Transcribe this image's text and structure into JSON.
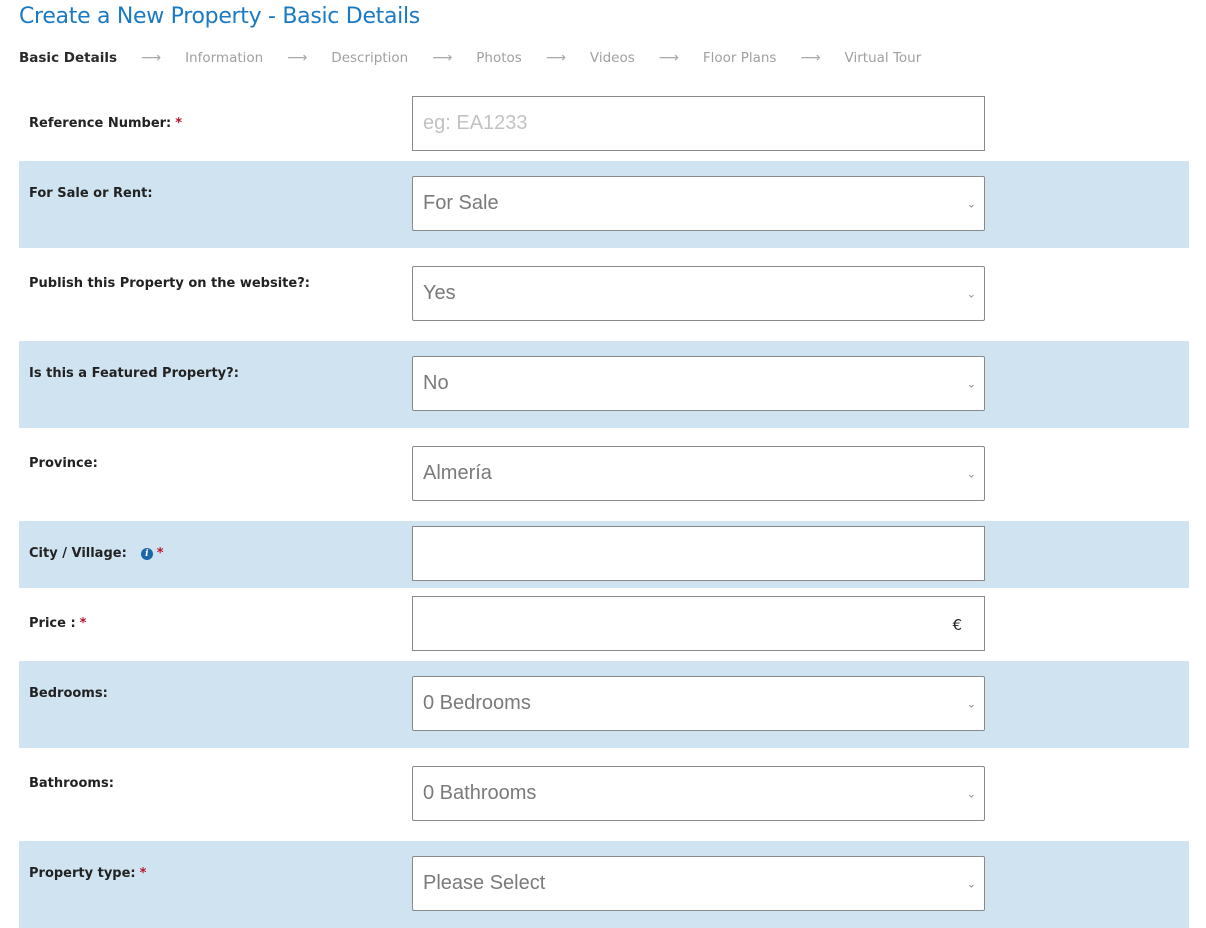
{
  "page": {
    "title": "Create a New Property - Basic Details"
  },
  "steps": [
    {
      "label": "Basic Details",
      "active": true
    },
    {
      "label": "Information",
      "active": false
    },
    {
      "label": "Description",
      "active": false
    },
    {
      "label": "Photos",
      "active": false
    },
    {
      "label": "Videos",
      "active": false
    },
    {
      "label": "Floor Plans",
      "active": false
    },
    {
      "label": "Virtual Tour",
      "active": false
    }
  ],
  "step_arrow": "⟶",
  "form": {
    "reference": {
      "label": "Reference Number:",
      "required": "*",
      "value": "",
      "placeholder": "eg: EA1233"
    },
    "sale_rent": {
      "label": "For Sale or Rent:",
      "value": "For Sale"
    },
    "publish": {
      "label": "Publish this Property on the website?:",
      "value": "Yes"
    },
    "featured": {
      "label": "Is this a Featured Property?:",
      "value": "No"
    },
    "province": {
      "label": "Province:",
      "value": "Almería"
    },
    "city": {
      "label": "City / Village:",
      "info_icon": "i",
      "required": "*",
      "value": ""
    },
    "price": {
      "label": "Price :",
      "required": "*",
      "value": "",
      "currency": "€"
    },
    "bedrooms": {
      "label": "Bedrooms:",
      "value": "0 Bedrooms"
    },
    "bathrooms": {
      "label": "Bathrooms:",
      "value": "0 Bathrooms"
    },
    "property_type": {
      "label": "Property type:",
      "required": "*",
      "value": "Please Select"
    }
  },
  "icons": {
    "chevron": "⌄"
  },
  "colors": {
    "title": "#1a7ac4",
    "row_alt_bg": "#cfe3f1",
    "required": "#b5162b",
    "info_icon": "#1a66a8"
  }
}
